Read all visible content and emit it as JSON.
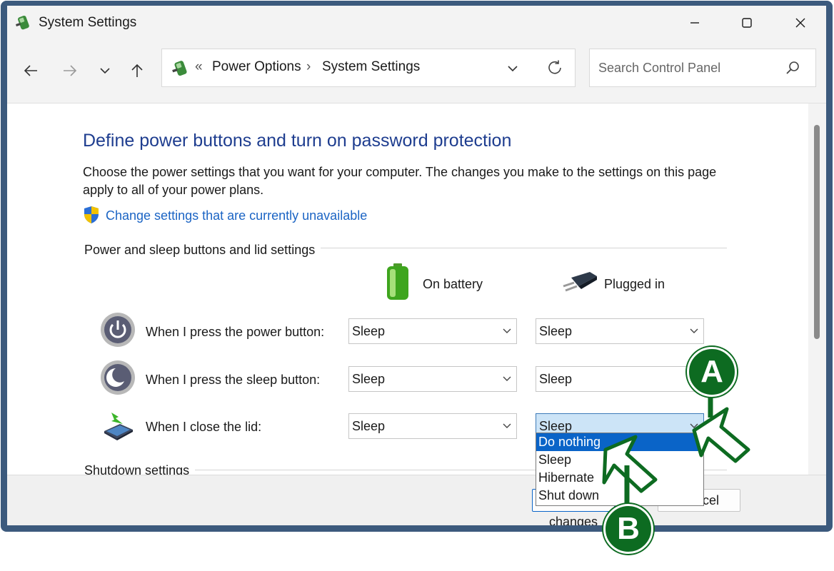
{
  "window": {
    "title": "System Settings",
    "controls": {
      "minimize": "minimize",
      "maximize": "maximize",
      "close": "close"
    }
  },
  "nav": {
    "breadcrumb_sep": "«",
    "breadcrumb": [
      "Power Options",
      "System Settings"
    ],
    "breadcrumb_arrow": "›",
    "search_placeholder": "Search Control Panel"
  },
  "page": {
    "heading": "Define power buttons and turn on password protection",
    "description": "Choose the power settings that you want for your computer. The changes you make to the settings on this page apply to all of your power plans.",
    "change_link": "Change settings that are currently unavailable",
    "section_buttons": "Power and sleep buttons and lid settings",
    "section_shutdown": "Shutdown settings",
    "col_battery": "On battery",
    "col_plugged": "Plugged in",
    "rows": [
      {
        "label": "When I press the power button:",
        "battery": "Sleep",
        "plugged": "Sleep"
      },
      {
        "label": "When I press the sleep button:",
        "battery": "Sleep",
        "plugged": "Sleep"
      },
      {
        "label": "When I close the lid:",
        "battery": "Sleep",
        "plugged": "Sleep"
      }
    ]
  },
  "dropdown": {
    "options": [
      "Do nothing",
      "Sleep",
      "Hibernate",
      "Shut down"
    ],
    "highlighted": "Do nothing"
  },
  "footer": {
    "save": "Save changes",
    "cancel": "Cancel"
  },
  "annotations": {
    "a": "A",
    "b": "B"
  },
  "colors": {
    "accent": "#0a64c8",
    "heading": "#1e3d8f",
    "link": "#1b64c4",
    "frame": "#3c5a7d",
    "callout": "#0d6b21"
  }
}
